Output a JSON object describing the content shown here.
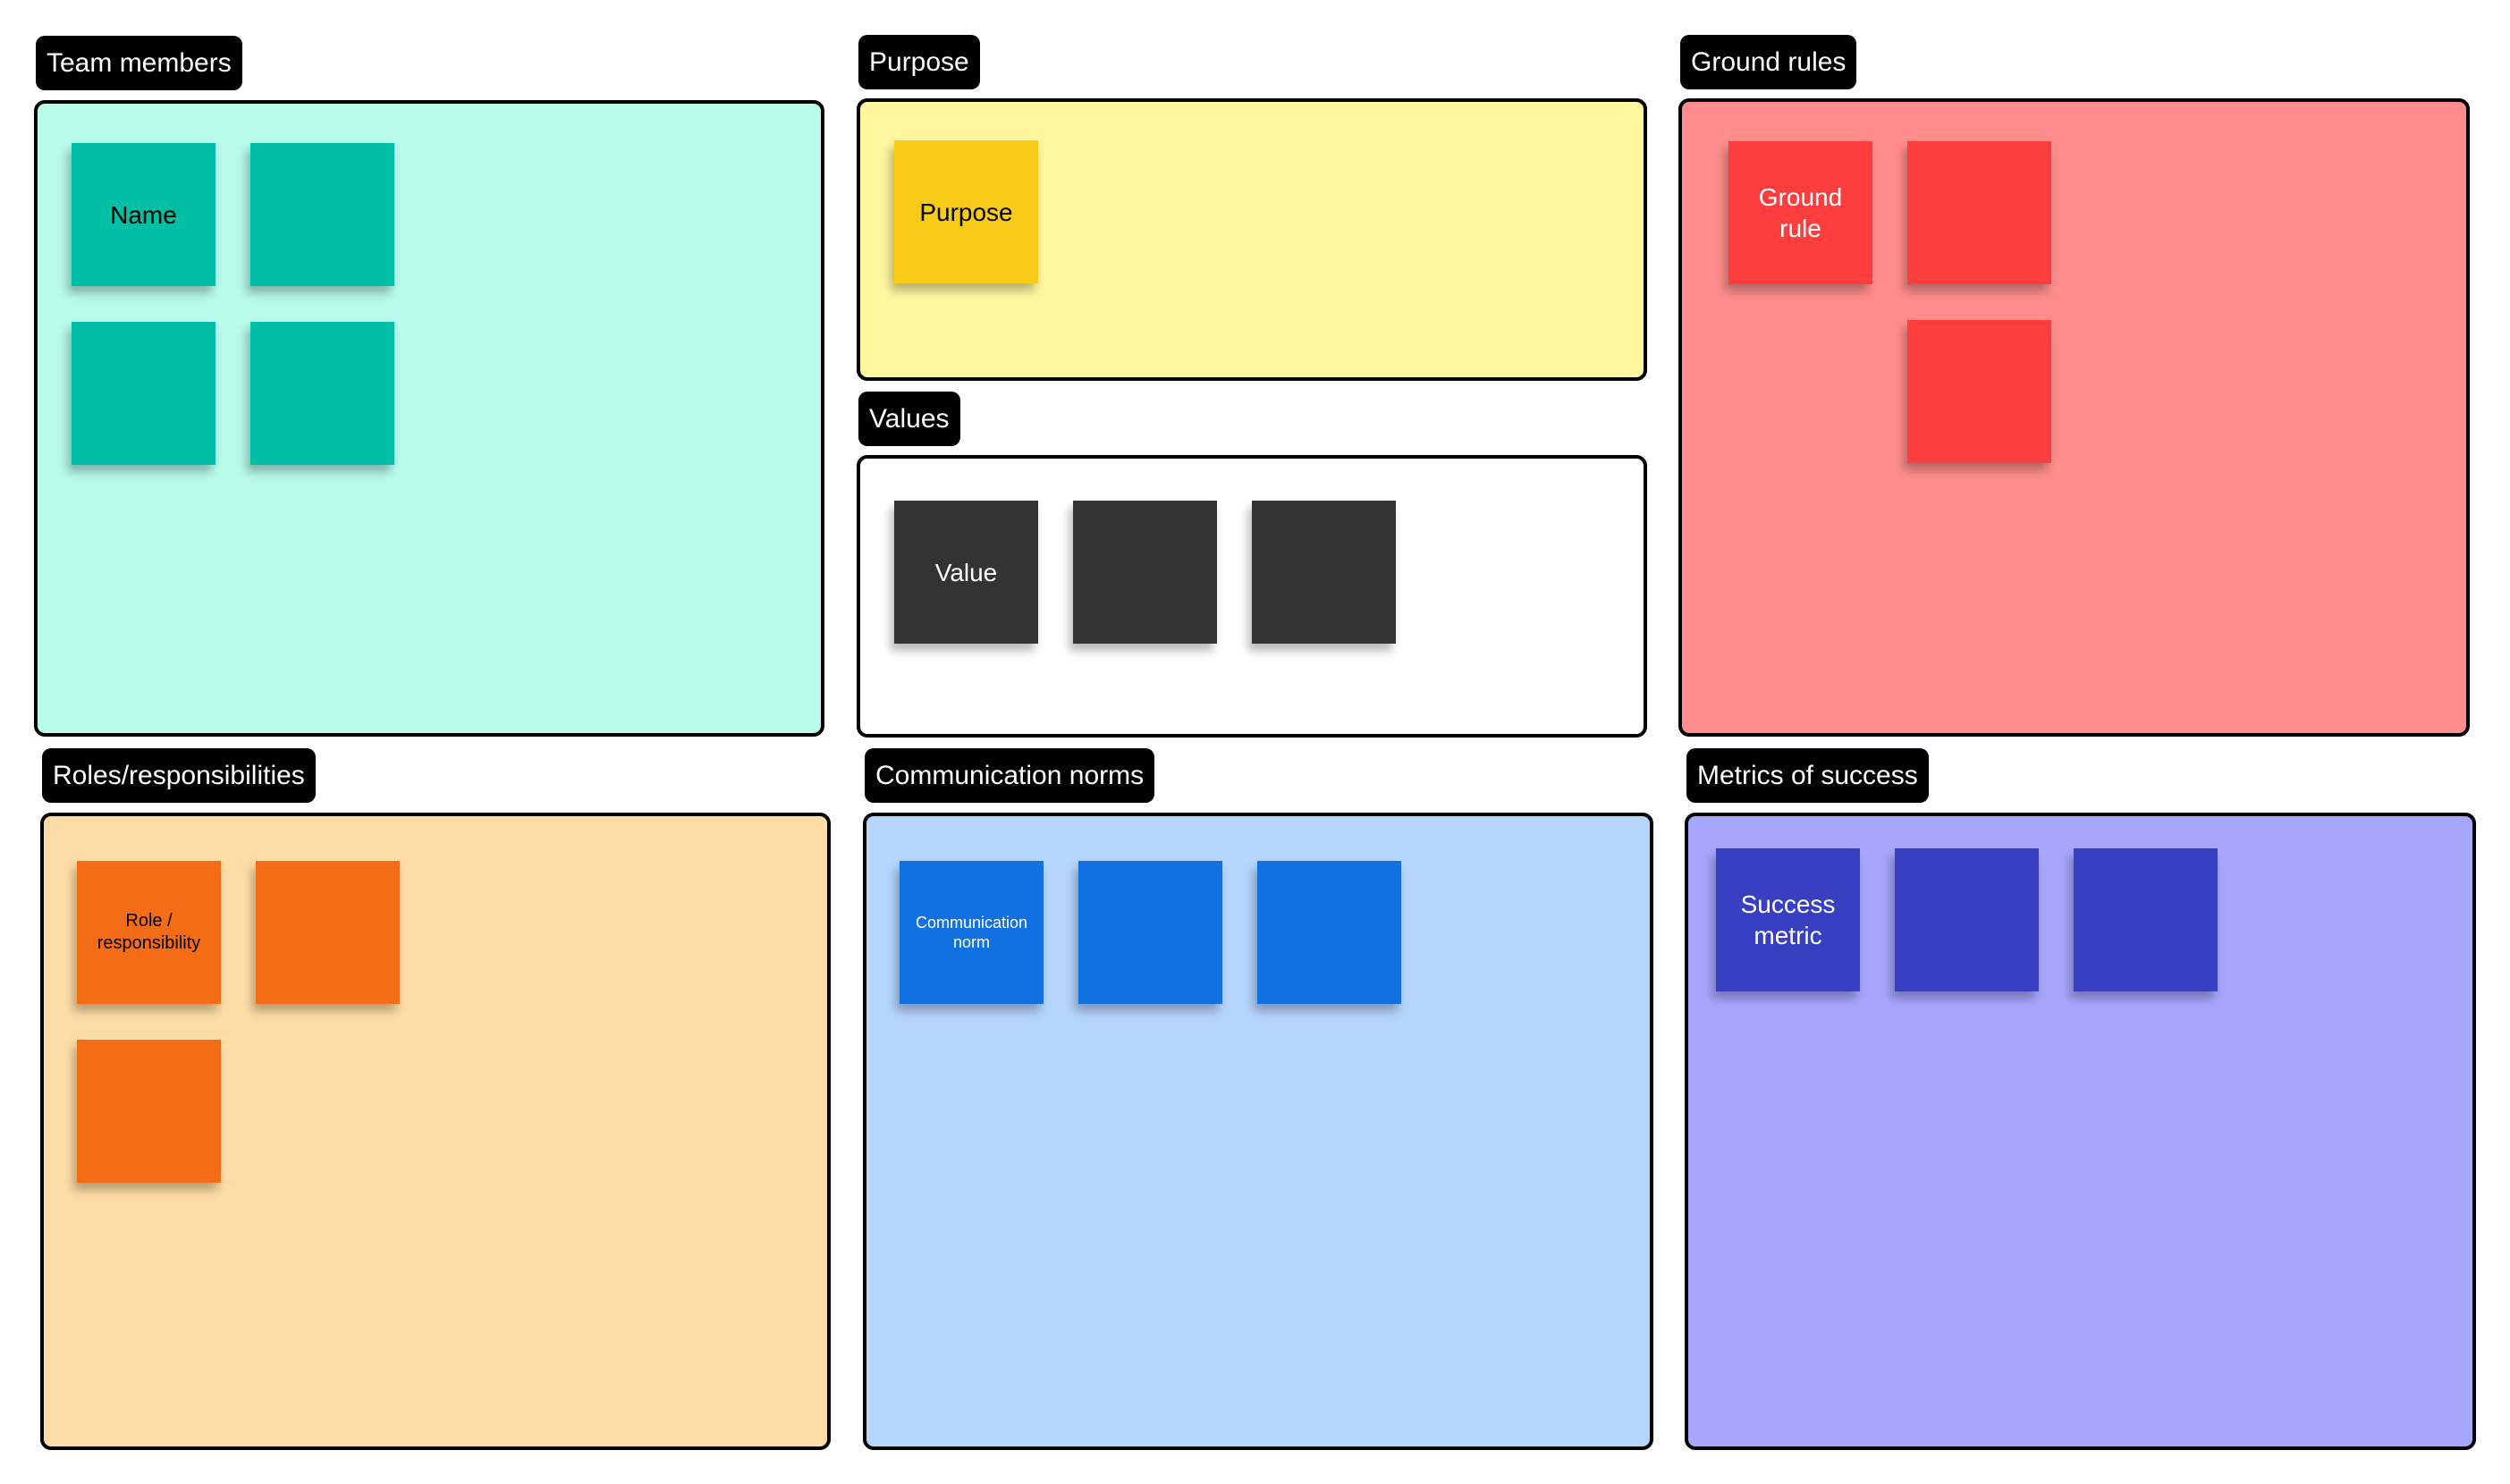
{
  "board": {
    "sections": {
      "team_members": {
        "title": "Team members",
        "panel_color": "#b8fbeb",
        "sticky_color": "#00bfa5",
        "stickies": [
          "Name",
          "",
          "",
          ""
        ]
      },
      "purpose": {
        "title": "Purpose",
        "panel_color": "#fff69e",
        "sticky_color": "#f8cb18",
        "stickies": [
          "Purpose"
        ]
      },
      "values": {
        "title": "Values",
        "panel_color": "#ffffff",
        "sticky_color": "#333333",
        "stickies": [
          "Value",
          "",
          ""
        ]
      },
      "ground_rules": {
        "title": "Ground rules",
        "panel_color": "#ff8d8d",
        "sticky_color": "#fe3d3d",
        "stickies": [
          "Ground rule",
          "",
          ""
        ]
      },
      "roles": {
        "title": "Roles/responsibilities",
        "panel_color": "#fddca6",
        "sticky_color": "#f56c16",
        "stickies": [
          "Role / responsibility",
          "",
          ""
        ]
      },
      "communication": {
        "title": "Communication norms",
        "panel_color": "#b6d5fd",
        "sticky_color": "#1271e1",
        "stickies": [
          "Communication norm",
          "",
          ""
        ]
      },
      "metrics": {
        "title": "Metrics of success",
        "panel_color": "#a6a6fc",
        "sticky_color": "#393fc1",
        "stickies": [
          "Success metric",
          "",
          ""
        ]
      }
    }
  }
}
